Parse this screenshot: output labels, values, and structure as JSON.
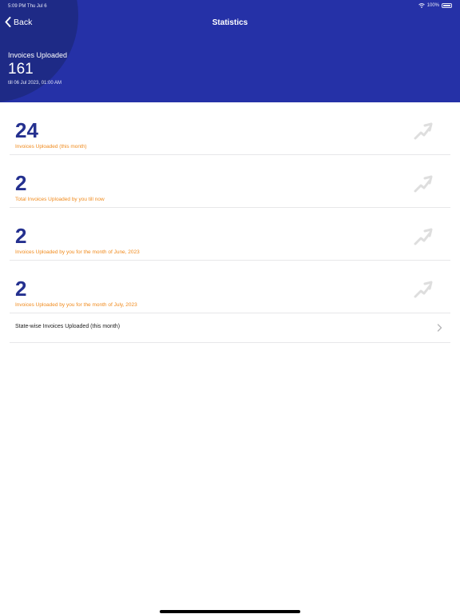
{
  "status_bar": {
    "time": "5:09 PM   Thu Jul 6",
    "battery": "100%"
  },
  "nav": {
    "back_label": "Back",
    "title": "Statistics"
  },
  "hero": {
    "label": "Invoices Uploaded",
    "value": "161",
    "date": "till 06 Jul 2023, 01:00 AM"
  },
  "stats": [
    {
      "value": "24",
      "label": "Invoices Uploaded (this month)"
    },
    {
      "value": "2",
      "label": "Total Invoices Uploaded by you till now"
    },
    {
      "value": "2",
      "label": "Invoices Uploaded by you for the month of June, 2023"
    },
    {
      "value": "2",
      "label": "Invoices Uploaded by you for the month of July, 2023"
    }
  ],
  "state_wise": {
    "label": "State-wise Invoices Uploaded (this month)"
  },
  "icons": {
    "back": "chevron-left-icon",
    "stat": "trend-arrow-icon",
    "state": "chevron-right-icon"
  },
  "colors": {
    "header": "#2531a7",
    "header_circle": "#1e2a86",
    "value": "#24308f",
    "label": "#f08a1c"
  }
}
